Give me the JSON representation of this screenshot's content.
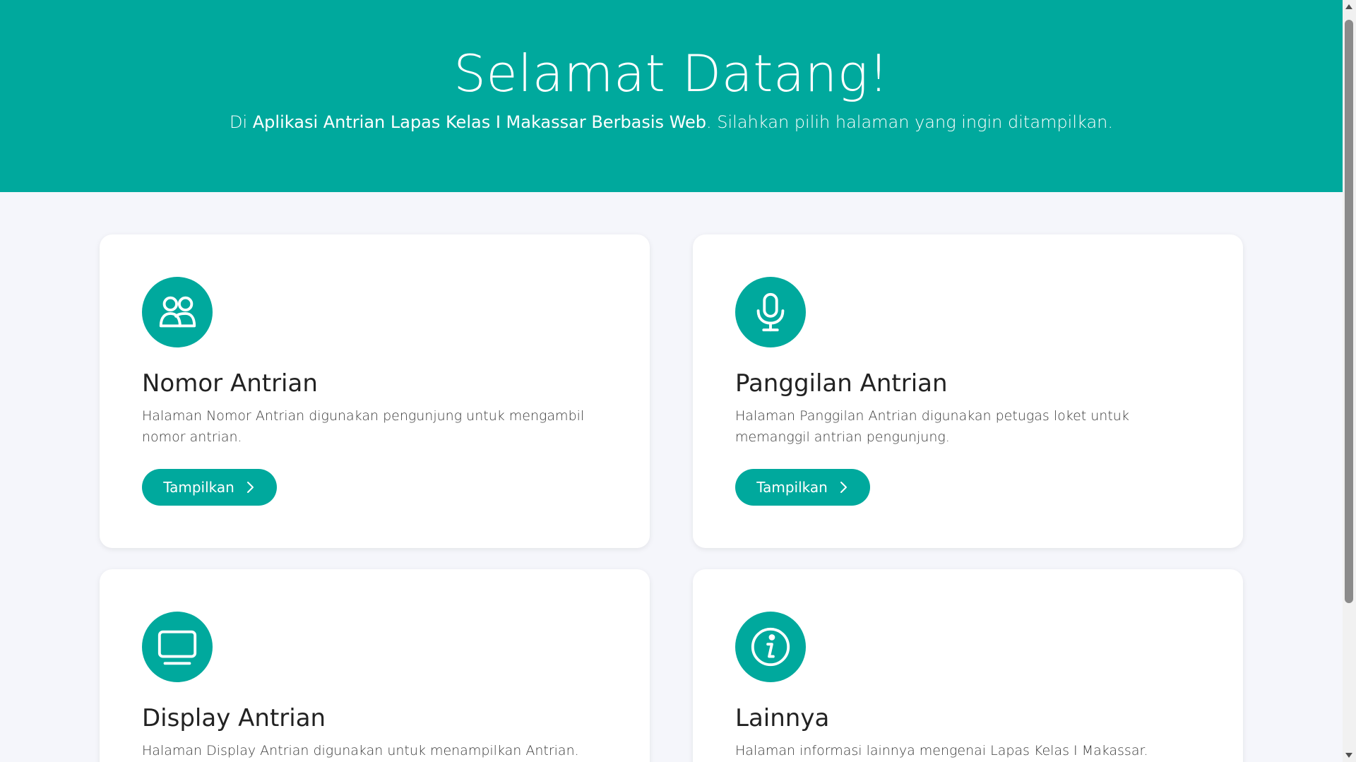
{
  "hero": {
    "title": "Selamat Datang!",
    "subtitle_prefix": "Di ",
    "subtitle_app_name": "Aplikasi Antrian Lapas Kelas I Makassar Berbasis Web",
    "subtitle_suffix": ". Silahkan pilih halaman yang ingin ditampilkan."
  },
  "cards": [
    {
      "icon": "people-icon",
      "title": "Nomor Antrian",
      "description": "Halaman Nomor Antrian digunakan pengunjung untuk mengambil nomor antrian.",
      "button_label": "Tampilkan"
    },
    {
      "icon": "microphone-icon",
      "title": "Panggilan Antrian",
      "description": "Halaman Panggilan Antrian digunakan petugas loket untuk memanggil antrian pengunjung.",
      "button_label": "Tampilkan"
    },
    {
      "icon": "monitor-icon",
      "title": "Display Antrian",
      "description": "Halaman Display Antrian digunakan untuk menampilkan Antrian."
    },
    {
      "icon": "info-icon",
      "title": "Lainnya",
      "description": "Halaman informasi lainnya mengenai Lapas Kelas I Makassar."
    }
  ],
  "colors": {
    "accent": "#00a99d",
    "page_background": "#f5f6fb",
    "card_background": "#ffffff"
  }
}
